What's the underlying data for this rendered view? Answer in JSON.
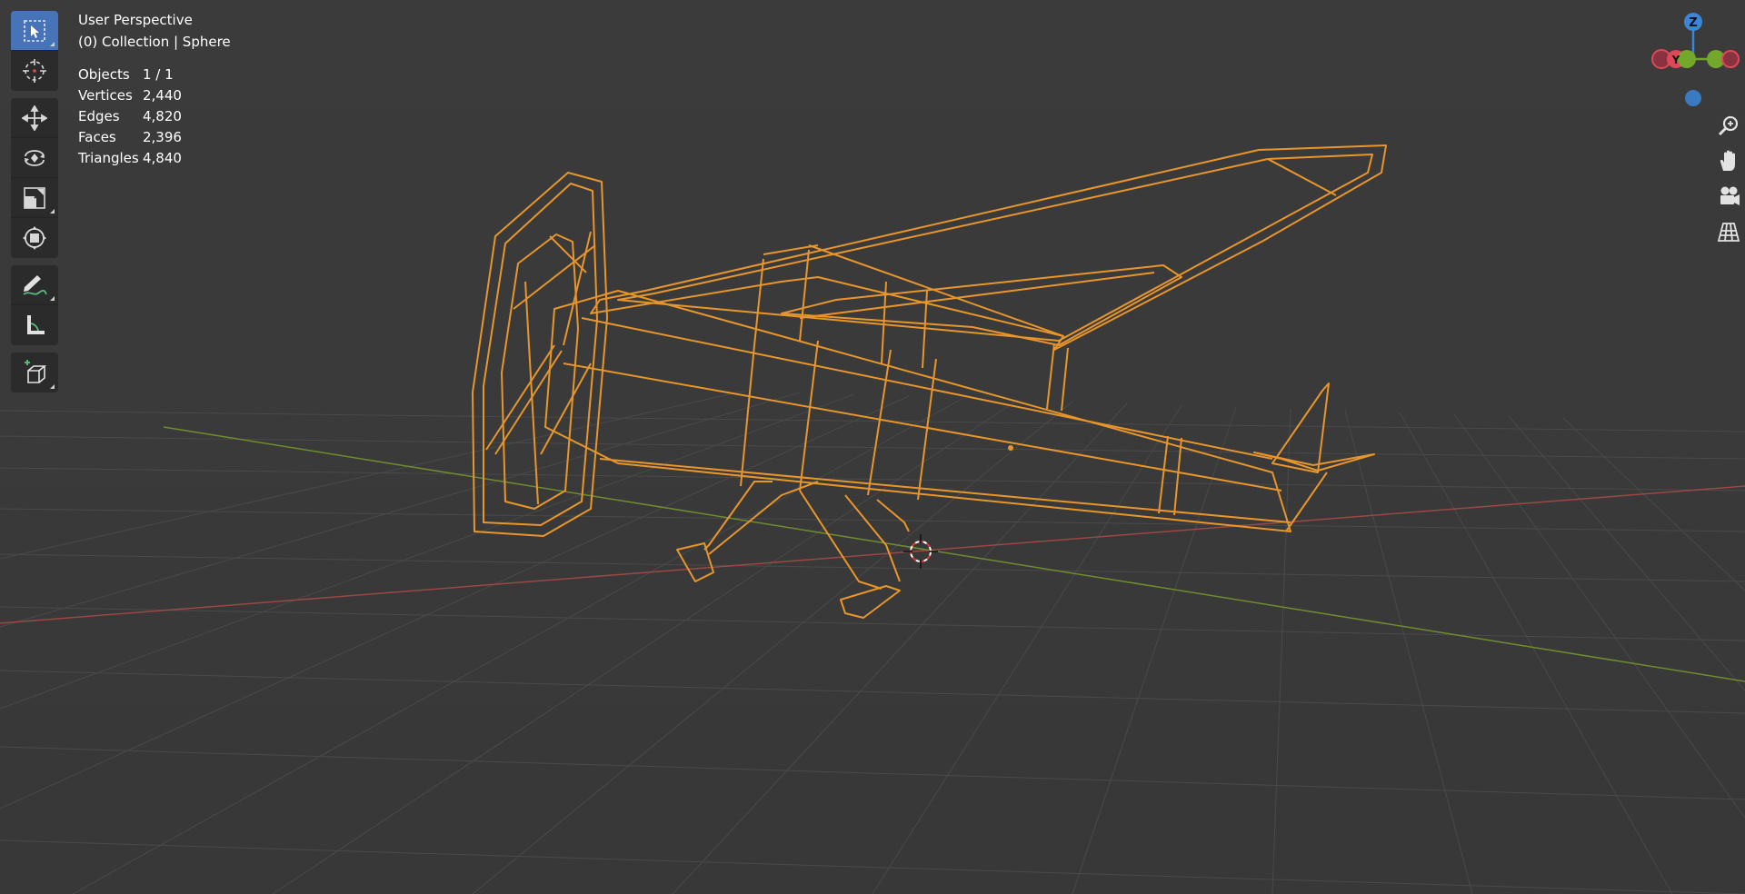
{
  "viewport": {
    "view_name": "User Perspective",
    "collection_info": "(0) Collection | Sphere",
    "wire_color": "#e8962c",
    "grid_color": "#4a4a4a",
    "x_axis_color": "#9b4848",
    "y_axis_color": "#6f8c2e",
    "background": "#3a3a3a"
  },
  "stats": [
    {
      "label": "Objects",
      "value": "1 / 1"
    },
    {
      "label": "Vertices",
      "value": "2,440"
    },
    {
      "label": "Edges",
      "value": "4,820"
    },
    {
      "label": "Faces",
      "value": "2,396"
    },
    {
      "label": "Triangles",
      "value": "4,840"
    }
  ],
  "toolbar": {
    "tools": [
      {
        "name": "select-box",
        "icon": "select-box-icon",
        "active": true
      },
      {
        "name": "cursor",
        "icon": "cursor-icon"
      },
      {
        "name": "move",
        "icon": "move-icon"
      },
      {
        "name": "rotate",
        "icon": "rotate-icon"
      },
      {
        "name": "scale",
        "icon": "scale-icon"
      },
      {
        "name": "transform",
        "icon": "transform-icon"
      },
      {
        "name": "annotate",
        "icon": "annotate-icon"
      },
      {
        "name": "measure",
        "icon": "measure-icon"
      },
      {
        "name": "add-cube",
        "icon": "add-cube-icon"
      }
    ]
  },
  "gizmo": {
    "z_label": "Z",
    "y_label": "Y",
    "x_color": "#e0485a",
    "y_color": "#73a82c",
    "z_color": "#3b86d8"
  },
  "navigation": [
    {
      "name": "zoom",
      "icon": "zoom-icon"
    },
    {
      "name": "pan",
      "icon": "hand-icon"
    },
    {
      "name": "camera",
      "icon": "camera-icon"
    },
    {
      "name": "perspective",
      "icon": "grid-icon"
    }
  ]
}
